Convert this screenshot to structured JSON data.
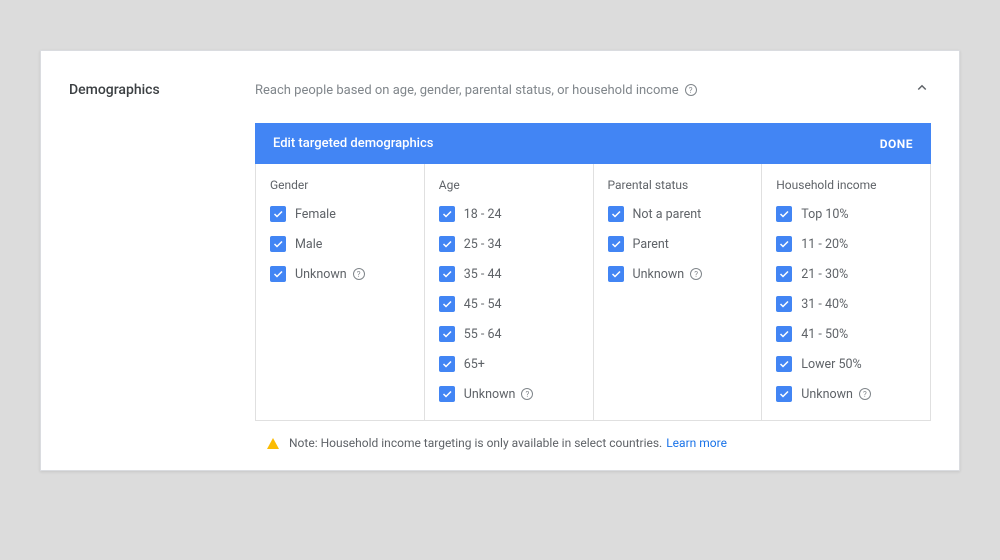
{
  "header": {
    "title": "Demographics",
    "description": "Reach people based on age, gender, parental status, or household income"
  },
  "panel": {
    "title": "Edit targeted demographics",
    "done_label": "DONE"
  },
  "columns": {
    "gender": {
      "heading": "Gender",
      "options": [
        {
          "label": "Female",
          "help": false
        },
        {
          "label": "Male",
          "help": false
        },
        {
          "label": "Unknown",
          "help": true
        }
      ]
    },
    "age": {
      "heading": "Age",
      "options": [
        {
          "label": "18 - 24",
          "help": false
        },
        {
          "label": "25 - 34",
          "help": false
        },
        {
          "label": "35 - 44",
          "help": false
        },
        {
          "label": "45 - 54",
          "help": false
        },
        {
          "label": "55 - 64",
          "help": false
        },
        {
          "label": "65+",
          "help": false
        },
        {
          "label": "Unknown",
          "help": true
        }
      ]
    },
    "parental": {
      "heading": "Parental status",
      "options": [
        {
          "label": "Not a parent",
          "help": false
        },
        {
          "label": "Parent",
          "help": false
        },
        {
          "label": "Unknown",
          "help": true
        }
      ]
    },
    "income": {
      "heading": "Household income",
      "options": [
        {
          "label": "Top 10%",
          "help": false
        },
        {
          "label": "11 - 20%",
          "help": false
        },
        {
          "label": "21 - 30%",
          "help": false
        },
        {
          "label": "31 - 40%",
          "help": false
        },
        {
          "label": "41 - 50%",
          "help": false
        },
        {
          "label": "Lower 50%",
          "help": false
        },
        {
          "label": "Unknown",
          "help": true
        }
      ]
    }
  },
  "footer": {
    "note": "Note: Household income targeting is only available in select countries.",
    "link": "Learn more"
  }
}
